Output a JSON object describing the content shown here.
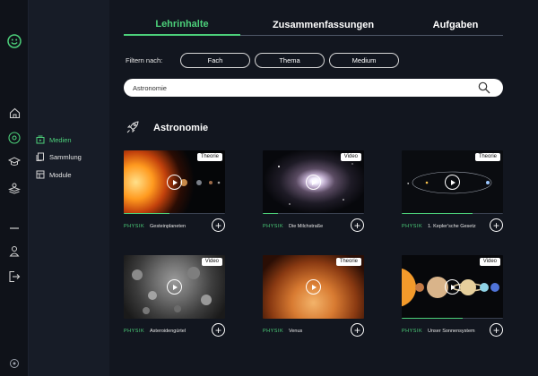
{
  "tabs": [
    {
      "label": "Lehrinhalte",
      "active": true
    },
    {
      "label": "Zusammenfassungen",
      "active": false
    },
    {
      "label": "Aufgaben",
      "active": false
    }
  ],
  "filters": {
    "label": "Filtern nach:",
    "options": [
      "Fach",
      "Thema",
      "Medium"
    ]
  },
  "search": {
    "value": "Astronomie"
  },
  "section": {
    "title": "Astronomie",
    "icon": "rocket-icon"
  },
  "subnav": [
    {
      "label": "Medien",
      "icon": "media-icon",
      "active": true
    },
    {
      "label": "Sammlung",
      "icon": "collection-icon",
      "active": false
    },
    {
      "label": "Module",
      "icon": "modules-icon",
      "active": false
    }
  ],
  "rail_icons": [
    "logo-icon",
    "home-icon",
    "compass-icon",
    "graduation-cap-icon",
    "layers-icon",
    "minus-icon",
    "user-icon",
    "logout-icon",
    "settings-icon"
  ],
  "cards": [
    {
      "subject": "PHYSIK",
      "title": "Gesteinplaneten",
      "badge": "Theorie",
      "progress": 0.45
    },
    {
      "subject": "PHYSIK",
      "title": "Die Milchstraße",
      "badge": "Video",
      "progress": 0.15
    },
    {
      "subject": "PHYSIK",
      "title": "1. Kepler'sche Gesetz",
      "badge": "Theorie",
      "progress": 0.7
    },
    {
      "subject": "PHYSIK",
      "title": "Asteroidengürtel",
      "badge": "Video",
      "progress": 0
    },
    {
      "subject": "PHYSIK",
      "title": "Venus",
      "badge": "Theorie",
      "progress": 0
    },
    {
      "subject": "PHYSIK",
      "title": "Unser Sonnensystem",
      "badge": "Video",
      "progress": 0.6
    }
  ],
  "colors": {
    "accent": "#4cd07a",
    "background": "#12161f",
    "sidebar": "#171c27"
  }
}
